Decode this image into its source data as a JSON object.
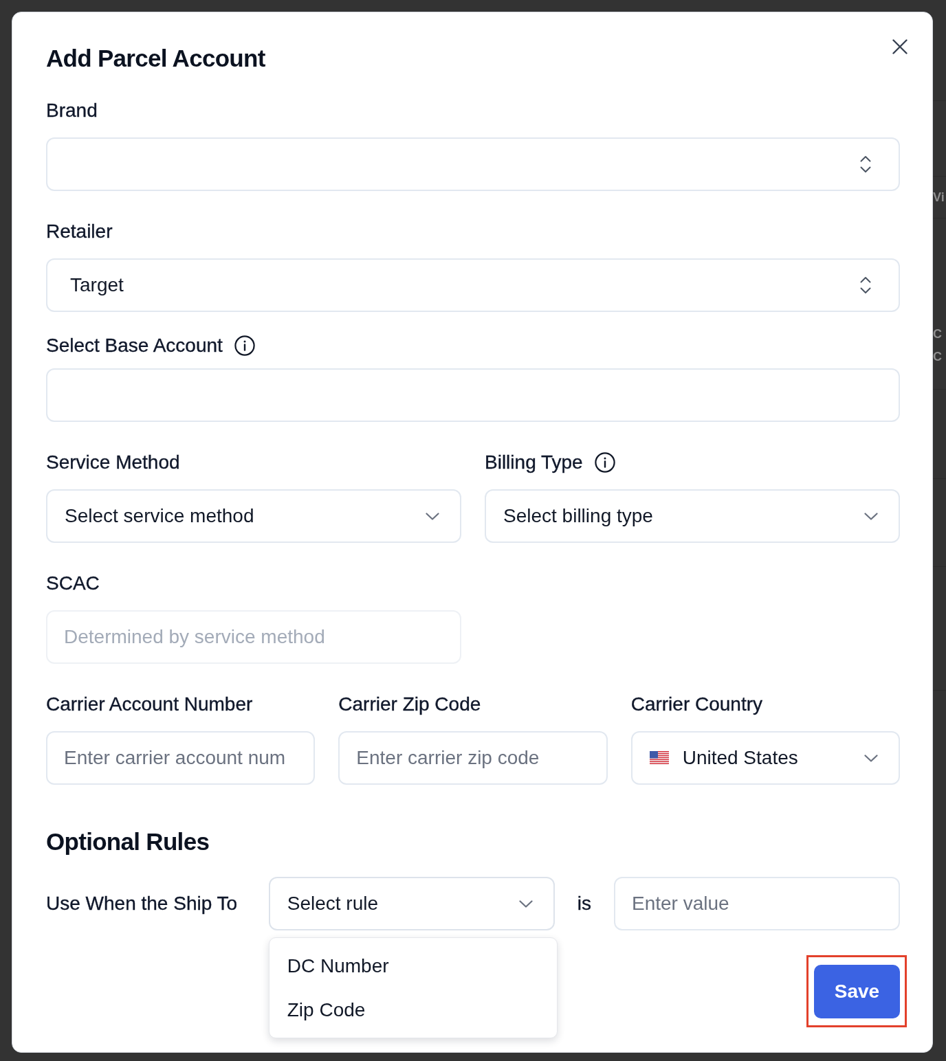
{
  "background_page": {
    "texts": [
      "Vi",
      "C",
      "C"
    ]
  },
  "dialog": {
    "title": "Add Parcel Account"
  },
  "brand": {
    "label": "Brand",
    "info": false,
    "kind": "combobox"
  },
  "retailer": {
    "label": "Retailer",
    "info": false,
    "kind": "combobox",
    "value": "Target"
  },
  "base_account": {
    "label": "Select Base Account",
    "info": true,
    "kind": "text_input",
    "disabled": false
  },
  "service_method": {
    "label": "Service Method",
    "info": false,
    "kind": "select",
    "value": "Select service method"
  },
  "billing_type": {
    "label": "Billing Type",
    "info": true,
    "kind": "select",
    "value": "Select billing type"
  },
  "scac": {
    "label": "SCAC",
    "info": false,
    "kind": "text_input",
    "placeholder": "Determined by service method",
    "disabled": true
  },
  "carrier_account_number": {
    "label": "Carrier Account Number",
    "info": false,
    "kind": "text_input",
    "placeholder": "Enter carrier account num",
    "disabled": false
  },
  "carrier_zip_code": {
    "label": "Carrier Zip Code",
    "info": false,
    "kind": "text_input",
    "placeholder": "Enter carrier zip code",
    "disabled": false
  },
  "carrier_country": {
    "label": "Carrier Country",
    "info": false,
    "kind": "country_select",
    "value": "United States"
  },
  "optional_rules": {
    "title": "Optional Rules",
    "condition_label": "Use When the Ship To",
    "rule_select": {
      "value": "Select rule",
      "expanded": true,
      "options": [
        {
          "label": "DC Number",
          "selected": false
        },
        {
          "label": "Zip Code",
          "selected": false
        }
      ]
    },
    "operator": "is",
    "value_field": {
      "placeholder": "Enter value"
    }
  },
  "save_button": {
    "label": "Save",
    "highlighted": true
  }
}
